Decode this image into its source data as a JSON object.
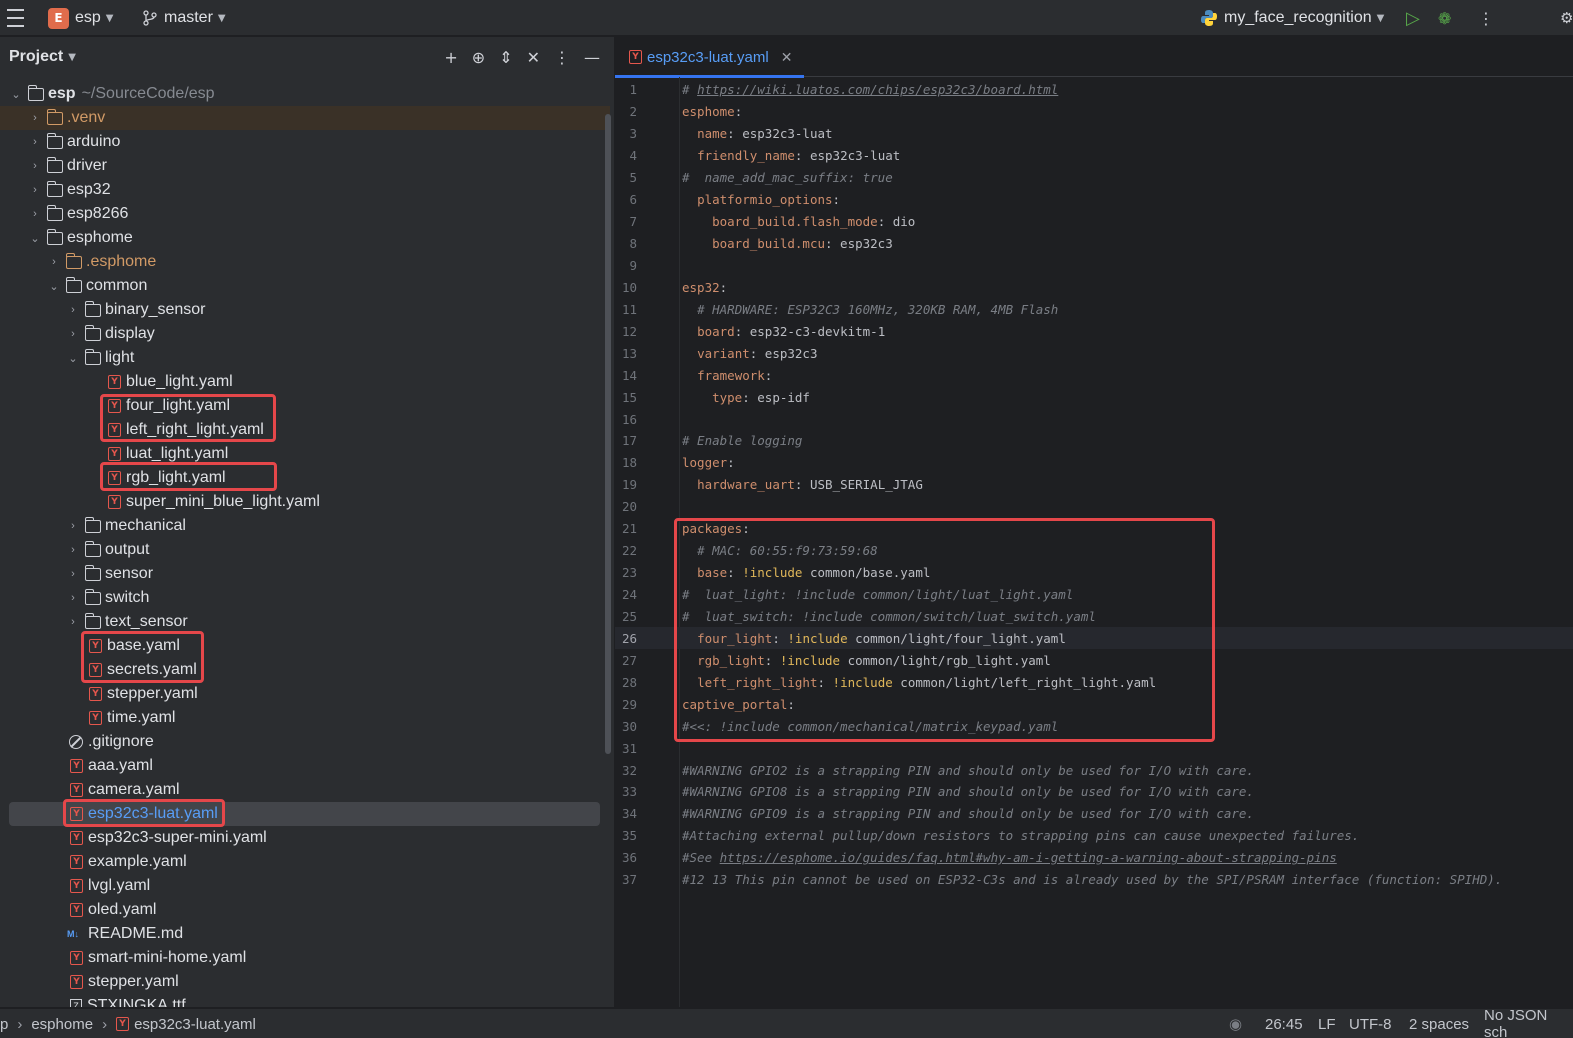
{
  "toolbar": {
    "project_initial": "E",
    "project_name": "esp",
    "branch": "master",
    "run_config": "my_face_recognition"
  },
  "project_panel": {
    "title": "Project",
    "root_name": "esp",
    "root_path": "~/SourceCode/esp",
    "items": [
      {
        "label": ".venv"
      },
      {
        "label": "arduino"
      },
      {
        "label": "driver"
      },
      {
        "label": "esp32"
      },
      {
        "label": "esp8266"
      },
      {
        "label": "esphome"
      },
      {
        "label": ".esphome"
      },
      {
        "label": "common"
      },
      {
        "label": "binary_sensor"
      },
      {
        "label": "display"
      },
      {
        "label": "light"
      },
      {
        "label": "blue_light.yaml"
      },
      {
        "label": "four_light.yaml"
      },
      {
        "label": "left_right_light.yaml"
      },
      {
        "label": "luat_light.yaml"
      },
      {
        "label": "rgb_light.yaml"
      },
      {
        "label": "super_mini_blue_light.yaml"
      },
      {
        "label": "mechanical"
      },
      {
        "label": "output"
      },
      {
        "label": "sensor"
      },
      {
        "label": "switch"
      },
      {
        "label": "text_sensor"
      },
      {
        "label": "base.yaml"
      },
      {
        "label": "secrets.yaml"
      },
      {
        "label": "stepper.yaml"
      },
      {
        "label": "time.yaml"
      },
      {
        "label": ".gitignore"
      },
      {
        "label": "aaa.yaml"
      },
      {
        "label": "camera.yaml"
      },
      {
        "label": "esp32c3-luat.yaml"
      },
      {
        "label": "esp32c3-super-mini.yaml"
      },
      {
        "label": "example.yaml"
      },
      {
        "label": "lvgl.yaml"
      },
      {
        "label": "oled.yaml"
      },
      {
        "label": "README.md"
      },
      {
        "label": "smart-mini-home.yaml"
      },
      {
        "label": "stepper.yaml"
      },
      {
        "label": "STXINGKA.ttf"
      }
    ]
  },
  "editor": {
    "tab_label": "esp32c3-luat.yaml",
    "current_line": 26,
    "lines": [
      [
        "# https://wiki.luatos.com/chips/esp32c3/board.html"
      ],
      [
        "esphome:"
      ],
      [
        "  name: esp32c3-luat"
      ],
      [
        "  friendly_name: esp32c3-luat"
      ],
      [
        "#  name_add_mac_suffix: true"
      ],
      [
        "  platformio_options:"
      ],
      [
        "    board_build.flash_mode: dio"
      ],
      [
        "    board_build.mcu: esp32c3"
      ],
      [
        ""
      ],
      [
        "esp32:"
      ],
      [
        "  # HARDWARE: ESP32C3 160MHz, 320KB RAM, 4MB Flash"
      ],
      [
        "  board: esp32-c3-devkitm-1"
      ],
      [
        "  variant: esp32c3"
      ],
      [
        "  framework:"
      ],
      [
        "    type: esp-idf"
      ],
      [
        ""
      ],
      [
        "# Enable logging"
      ],
      [
        "logger:"
      ],
      [
        "  hardware_uart: USB_SERIAL_JTAG"
      ],
      [
        ""
      ],
      [
        "packages:"
      ],
      [
        "  # MAC: 60:55:f9:73:59:68"
      ],
      [
        "  base: !include common/base.yaml"
      ],
      [
        "#  luat_light: !include common/light/luat_light.yaml"
      ],
      [
        "#  luat_switch: !include common/switch/luat_switch.yaml"
      ],
      [
        "  four_light: !include common/light/four_light.yaml"
      ],
      [
        "  rgb_light: !include common/light/rgb_light.yaml"
      ],
      [
        "  left_right_light: !include common/light/left_right_light.yaml"
      ],
      [
        "captive_portal:"
      ],
      [
        "#<<: !include common/mechanical/matrix_keypad.yaml"
      ],
      [
        ""
      ],
      [
        "#WARNING GPIO2 is a strapping PIN and should only be used for I/O with care."
      ],
      [
        "#WARNING GPIO8 is a strapping PIN and should only be used for I/O with care."
      ],
      [
        "#WARNING GPIO9 is a strapping PIN and should only be used for I/O with care."
      ],
      [
        "#Attaching external pullup/down resistors to strapping pins can cause unexpected failures."
      ],
      [
        "#See https://esphome.io/guides/faq.html#why-am-i-getting-a-warning-about-strapping-pins"
      ],
      [
        "#12 13 This pin cannot be used on ESP32-C3s and is already used by the SPI/PSRAM interface (function: SPIHD)."
      ]
    ]
  },
  "statusbar": {
    "breadcrumb_prefix": "p",
    "breadcrumb_folder": "esphome",
    "breadcrumb_file": "esp32c3-luat.yaml",
    "position": "26:45",
    "line_sep": "LF",
    "encoding": "UTF-8",
    "indent": "2 spaces",
    "schema": "No JSON sch"
  },
  "colors": {
    "highlight_box": "#e5474a",
    "accent": "#3574f0"
  }
}
